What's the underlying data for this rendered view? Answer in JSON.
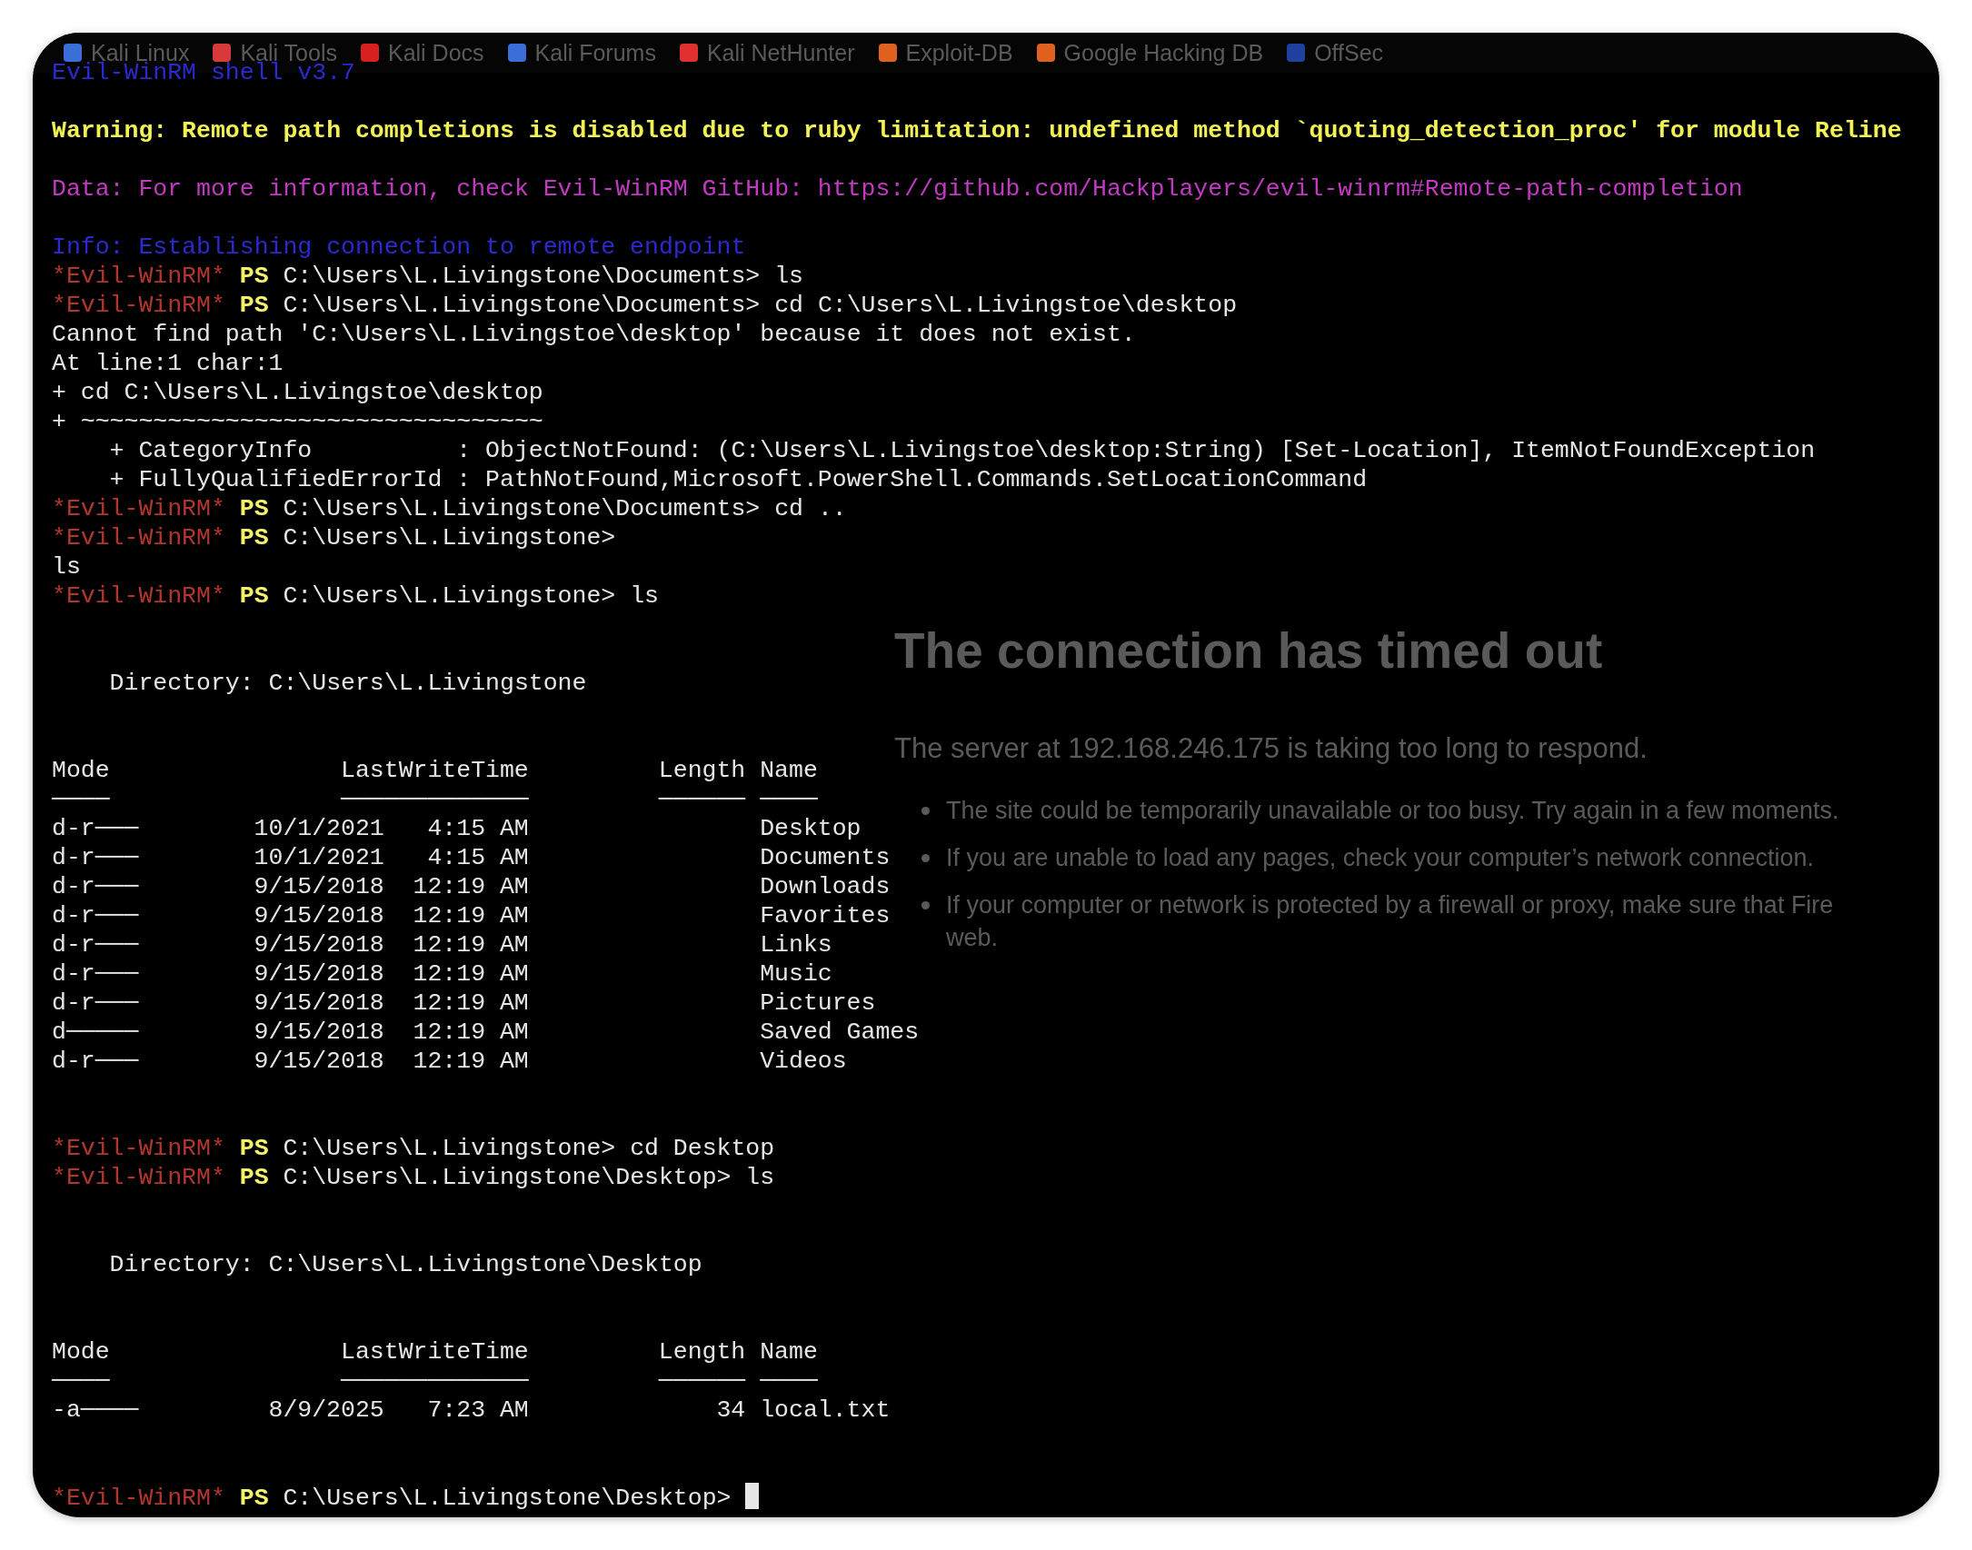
{
  "browser": {
    "bookmarks": [
      {
        "label": "Kali Linux",
        "color": "#3a6fd8"
      },
      {
        "label": "Kali Tools",
        "color": "#d83a3a"
      },
      {
        "label": "Kali Docs",
        "color": "#d82020"
      },
      {
        "label": "Kali Forums",
        "color": "#3a6fd8"
      },
      {
        "label": "Kali NetHunter",
        "color": "#e03030"
      },
      {
        "label": "Exploit-DB",
        "color": "#e06020"
      },
      {
        "label": "Google Hacking DB",
        "color": "#e06020"
      },
      {
        "label": "OffSec",
        "color": "#2040a0"
      }
    ],
    "error_page": {
      "title": "The connection has timed out",
      "message": "The server at 192.168.246.175 is taking too long to respond.",
      "bullets": [
        {
          "text": "The site could be temporarily unavailable or too busy. Try again in a few moments."
        },
        {
          "text": "If you are unable to load any pages, check your computer’s network connection."
        },
        {
          "text": "If your computer or network is protected by a firewall or proxy, make sure that Fire",
          "continuation": "web."
        }
      ]
    }
  },
  "terminal": {
    "lines": [
      {
        "kind": "banner",
        "text": "Evil-WinRM shell v3.7"
      },
      {
        "kind": "blank"
      },
      {
        "kind": "warning",
        "text": "Warning: Remote path completions is disabled due to ruby limitation: undefined method `quoting_detection_proc' for module Reline"
      },
      {
        "kind": "blank"
      },
      {
        "kind": "data",
        "text": "Data: For more information, check Evil-WinRM GitHub: https://github.com/Hackplayers/evil-winrm#Remote-path-completion"
      },
      {
        "kind": "blank"
      },
      {
        "kind": "info",
        "text": "Info: Establishing connection to remote endpoint"
      },
      {
        "kind": "prompt",
        "tag": "*Evil-WinRM*",
        "shell": "PS",
        "path": "C:\\Users\\L.Livingstone\\Documents>",
        "command": "ls"
      },
      {
        "kind": "prompt",
        "tag": "*Evil-WinRM*",
        "shell": "PS",
        "path": "C:\\Users\\L.Livingstone\\Documents>",
        "command": "cd C:\\Users\\L.Livingstoe\\desktop"
      },
      {
        "kind": "output",
        "text": "Cannot find path 'C:\\Users\\L.Livingstoe\\desktop' because it does not exist."
      },
      {
        "kind": "output",
        "text": "At line:1 char:1"
      },
      {
        "kind": "output",
        "text": "+ cd C:\\Users\\L.Livingstoe\\desktop"
      },
      {
        "kind": "output",
        "text": "+ ~~~~~~~~~~~~~~~~~~~~~~~~~~~~~~~~"
      },
      {
        "kind": "output",
        "text": "    + CategoryInfo          : ObjectNotFound: (C:\\Users\\L.Livingstoe\\desktop:String) [Set-Location], ItemNotFoundException"
      },
      {
        "kind": "output",
        "text": "    + FullyQualifiedErrorId : PathNotFound,Microsoft.PowerShell.Commands.SetLocationCommand"
      },
      {
        "kind": "prompt",
        "tag": "*Evil-WinRM*",
        "shell": "PS",
        "path": "C:\\Users\\L.Livingstone\\Documents>",
        "command": "cd .."
      },
      {
        "kind": "prompt",
        "tag": "*Evil-WinRM*",
        "shell": "PS",
        "path": "C:\\Users\\L.Livingstone>"
      },
      {
        "kind": "output",
        "text": "ls"
      },
      {
        "kind": "prompt",
        "tag": "*Evil-WinRM*",
        "shell": "PS",
        "path": "C:\\Users\\L.Livingstone>",
        "command": "ls"
      },
      {
        "kind": "blank"
      },
      {
        "kind": "blank"
      },
      {
        "kind": "output",
        "text": "    Directory: C:\\Users\\L.Livingstone"
      },
      {
        "kind": "blank"
      },
      {
        "kind": "blank"
      },
      {
        "kind": "table",
        "columns": [
          "Mode",
          "LastWriteTime",
          "Length",
          "Name"
        ],
        "rules": [
          "────",
          "─────────────",
          "──────",
          "────"
        ],
        "rows": [
          {
            "mode": "d-r───",
            "date": "10/1/2021",
            "time": "4:15 AM",
            "name": "Desktop"
          },
          {
            "mode": "d-r───",
            "date": "10/1/2021",
            "time": "4:15 AM",
            "name": "Documents"
          },
          {
            "mode": "d-r───",
            "date": "9/15/2018",
            "time": "12:19 AM",
            "name": "Downloads"
          },
          {
            "mode": "d-r───",
            "date": "9/15/2018",
            "time": "12:19 AM",
            "name": "Favorites"
          },
          {
            "mode": "d-r───",
            "date": "9/15/2018",
            "time": "12:19 AM",
            "name": "Links"
          },
          {
            "mode": "d-r───",
            "date": "9/15/2018",
            "time": "12:19 AM",
            "name": "Music"
          },
          {
            "mode": "d-r───",
            "date": "9/15/2018",
            "time": "12:19 AM",
            "name": "Pictures"
          },
          {
            "mode": "d─────",
            "date": "9/15/2018",
            "time": "12:19 AM",
            "name": "Saved Games"
          },
          {
            "mode": "d-r───",
            "date": "9/15/2018",
            "time": "12:19 AM",
            "name": "Videos"
          }
        ]
      },
      {
        "kind": "blank"
      },
      {
        "kind": "blank"
      },
      {
        "kind": "prompt",
        "tag": "*Evil-WinRM*",
        "shell": "PS",
        "path": "C:\\Users\\L.Livingstone>",
        "command": "cd Desktop"
      },
      {
        "kind": "prompt",
        "tag": "*Evil-WinRM*",
        "shell": "PS",
        "path": "C:\\Users\\L.Livingstone\\Desktop>",
        "command": "ls"
      },
      {
        "kind": "blank"
      },
      {
        "kind": "blank"
      },
      {
        "kind": "output",
        "text": "    Directory: C:\\Users\\L.Livingstone\\Desktop"
      },
      {
        "kind": "blank"
      },
      {
        "kind": "blank"
      },
      {
        "kind": "table",
        "columns": [
          "Mode",
          "LastWriteTime",
          "Length",
          "Name"
        ],
        "rules": [
          "────",
          "─────────────",
          "──────",
          "────"
        ],
        "rows": [
          {
            "mode": "-a────",
            "date": "8/9/2025",
            "time": "7:23 AM",
            "length": "34",
            "name": "local.txt"
          }
        ]
      },
      {
        "kind": "blank"
      },
      {
        "kind": "blank"
      },
      {
        "kind": "prompt",
        "tag": "*Evil-WinRM*",
        "shell": "PS",
        "path": "C:\\Users\\L.Livingstone\\Desktop>",
        "cursor": true
      }
    ]
  }
}
